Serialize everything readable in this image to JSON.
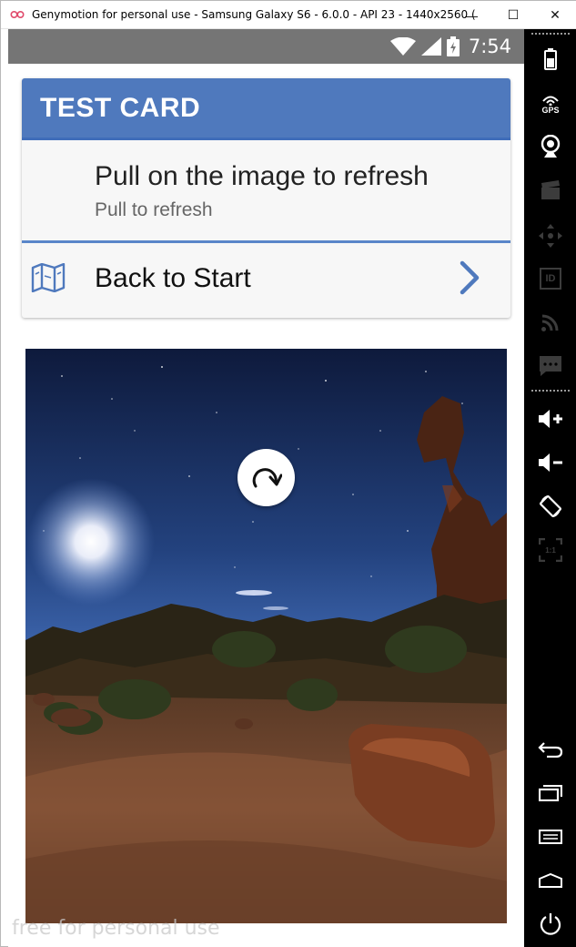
{
  "window": {
    "title": "Genymotion for personal use - Samsung Galaxy S6 - 6.0.0 - API 23 - 1440x2560 (1440x2...",
    "controls": {
      "minimize": "—",
      "maximize": "☐",
      "close": "✕"
    }
  },
  "statusbar": {
    "time": "7:54"
  },
  "card": {
    "header_title": "TEST CARD",
    "primary_text": "Pull on the image to refresh",
    "secondary_text": "Pull to refresh",
    "nav_label": "Back to Start",
    "colors": {
      "header": "#4f79bd",
      "accent": "#5a86c9"
    }
  },
  "watermark": "free for personal use",
  "toolbar": {
    "gps_label": "GPS",
    "id_label": "ID",
    "scale_label": "1:1",
    "icons": [
      "battery-icon",
      "gps-icon",
      "webcam-icon",
      "clapper-icon",
      "dpad-icon",
      "id-icon",
      "cast-icon",
      "sms-icon",
      "volume-up-icon",
      "volume-down-icon",
      "rotate-icon",
      "scale-icon",
      "back-icon",
      "recent-apps-icon",
      "menu-icon",
      "home-icon",
      "power-icon"
    ]
  }
}
